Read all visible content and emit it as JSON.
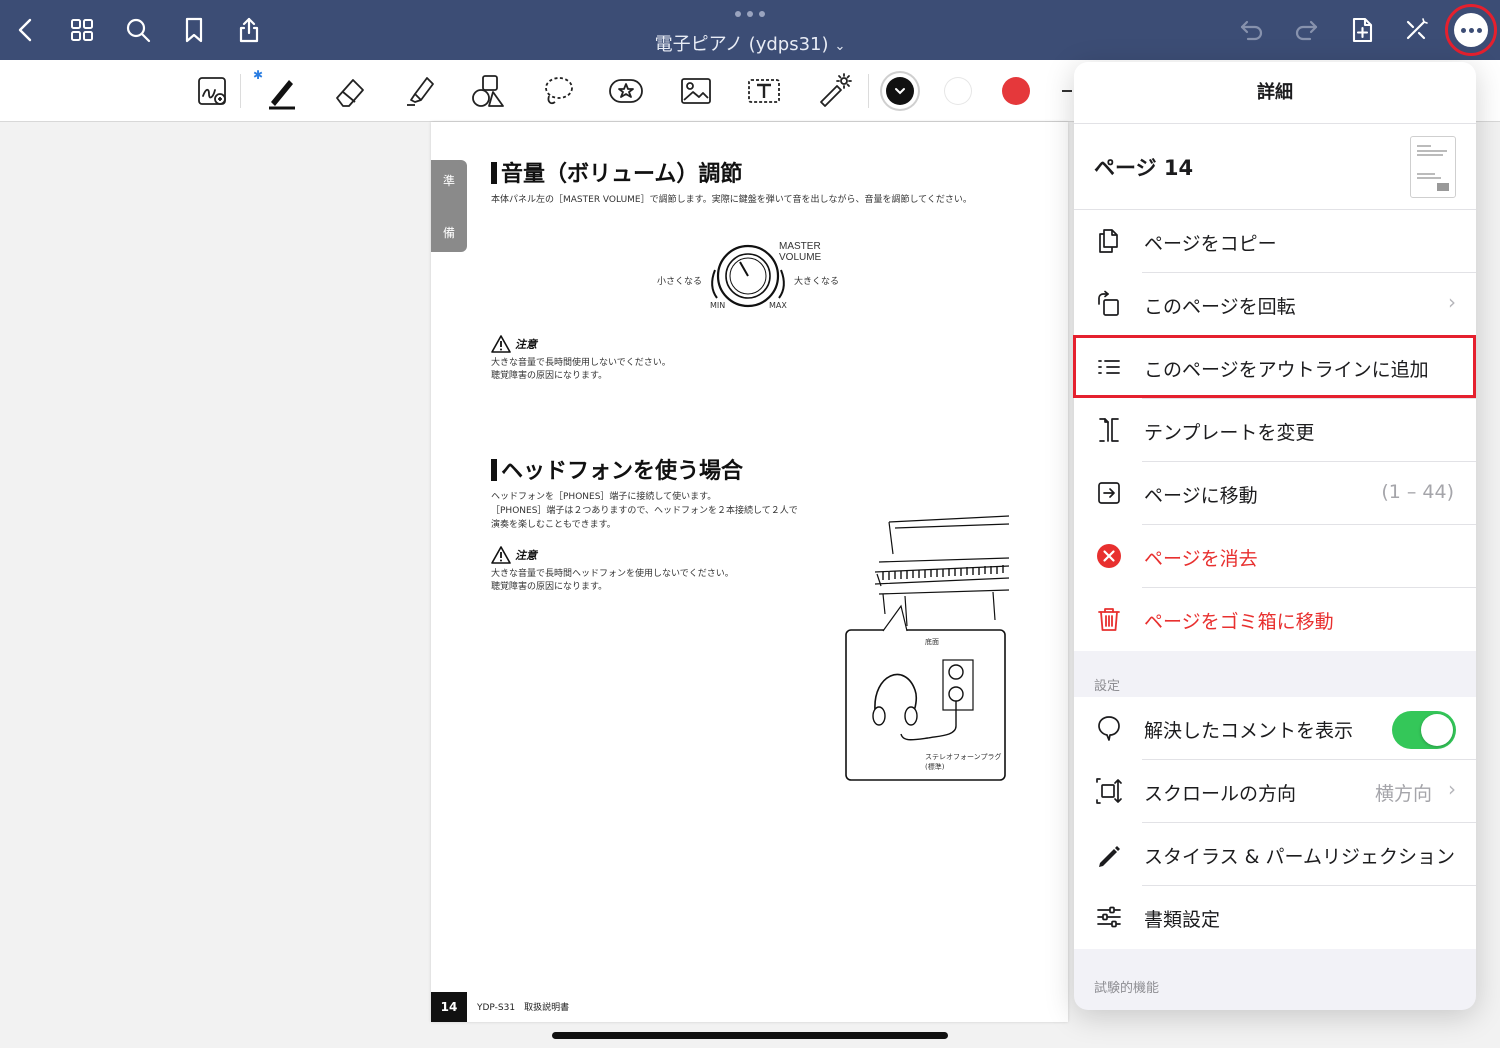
{
  "app": {
    "document_title": "電子ピアノ (ydps31)",
    "title_chevron": "⌄"
  },
  "toolbar": {
    "pen_color_selected": "#111111",
    "colors": [
      "#111111",
      "#ffffff",
      "#e5383b"
    ],
    "bluetooth_glyph": "✱"
  },
  "document": {
    "side_tab": [
      "準",
      "備"
    ],
    "section1": {
      "title": "音量（ボリューム）調節",
      "body": "本体パネル左の［MASTER VOLUME］で調節します。実際に鍵盤を弾いて音を出しながら、音量を調節してください。",
      "knob_label_top": "MASTER",
      "knob_label_top2": "VOLUME",
      "knob_left": "小さくなる",
      "knob_right": "大きくなる",
      "knob_min": "MIN",
      "knob_max": "MAX",
      "caution_title": "注意",
      "caution_line1": "大きな音量で長時間使用しないでください。",
      "caution_line2": "聴覚障害の原因になります。"
    },
    "section2": {
      "title": "ヘッドフォンを使う場合",
      "body1": "ヘッドフォンを［PHONES］端子に接続して使います。",
      "body2": "［PHONES］端子は２つありますので、ヘッドフォンを２本接続して２人で",
      "body3": "演奏を楽しむこともできます。",
      "caution_title": "注意",
      "caution_line1": "大きな音量で長時間ヘッドフォンを使用しないでください。",
      "caution_line2": "聴覚障害の原因になります。",
      "illus_label_bottom": "底面",
      "illus_label_plug": "ステレオフォーンプラグ",
      "illus_label_plug2": "(標準)"
    },
    "footer_page": "14",
    "footer_text": "YDP-S31　取扱説明書"
  },
  "popover": {
    "title": "詳細",
    "page_label": "ページ 14",
    "items": [
      {
        "label": "ページをコピー",
        "icon": "copy-icon"
      },
      {
        "label": "このページを回転",
        "icon": "rotate-icon",
        "chevron": "›"
      },
      {
        "label": "このページをアウトラインに追加",
        "icon": "outline-list-icon"
      },
      {
        "label": "テンプレートを変更",
        "icon": "template-icon"
      },
      {
        "label": "ページに移動",
        "icon": "goto-page-icon",
        "value": "(1 – 44)"
      },
      {
        "label": "ページを消去",
        "icon": "clear-icon"
      },
      {
        "label": "ページをゴミ箱に移動",
        "icon": "trash-icon"
      }
    ],
    "settings_label": "設定",
    "settings": [
      {
        "label": "解決したコメントを表示",
        "icon": "comment-icon",
        "toggle": true
      },
      {
        "label": "スクロールの方向",
        "icon": "scroll-direction-icon",
        "value": "横方向",
        "chevron": "›"
      },
      {
        "label": "スタイラス & パームリジェクション",
        "icon": "pencil-icon"
      },
      {
        "label": "書類設定",
        "icon": "sliders-icon"
      }
    ],
    "experimental_label": "試験的機能"
  },
  "colors": {
    "nav_bar": "#3c4d75",
    "accent_red": "#e5202e",
    "toggle_on": "#34c759",
    "destructive": "#e8302f"
  }
}
